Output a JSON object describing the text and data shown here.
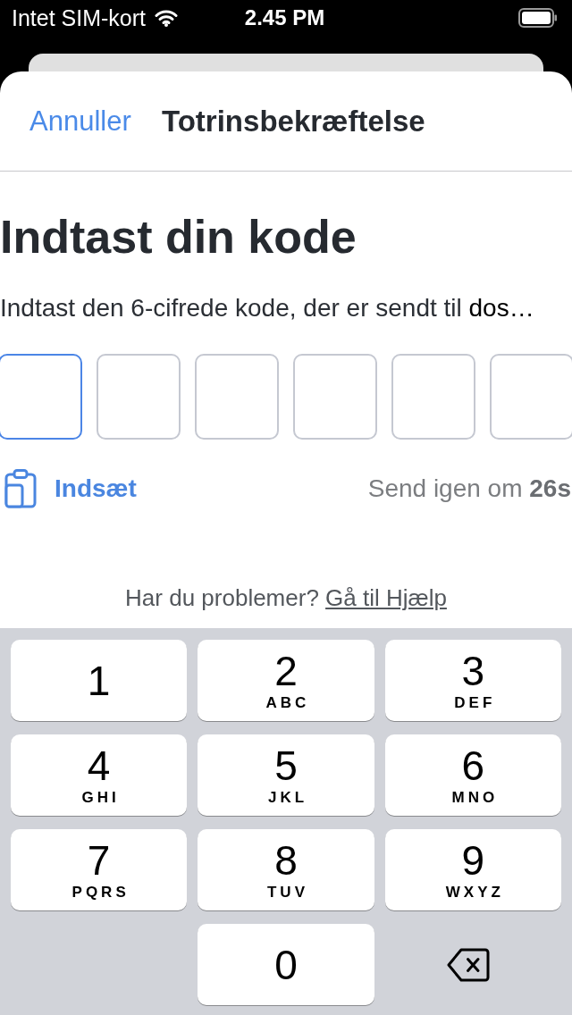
{
  "status_bar": {
    "carrier": "Intet SIM-kort",
    "time": "2.45 PM"
  },
  "header": {
    "cancel": "Annuller",
    "title": "Totrinsbekræftelse"
  },
  "heading": "Indtast din kode",
  "instruction": {
    "text": "Indtast den 6-cifrede kode, der er sendt til",
    "recipient": "dos…"
  },
  "code_fields": [
    {
      "selected": true
    },
    {
      "selected": false
    },
    {
      "selected": false
    },
    {
      "selected": false
    },
    {
      "selected": false
    },
    {
      "selected": false
    }
  ],
  "paste_button": "Indsæt",
  "resend": "Send igen om **26s**",
  "help": {
    "text": "Har du problemer?",
    "link": "Gå til Hjælp"
  },
  "keypad": [
    {
      "kind": "digit",
      "digit": "1"
    },
    {
      "kind": "digit",
      "digit": "2",
      "letters": "ABC"
    },
    {
      "kind": "digit",
      "digit": "3",
      "letters": "DEF"
    },
    {
      "kind": "digit",
      "digit": "4",
      "letters": "GHI"
    },
    {
      "kind": "digit",
      "digit": "5",
      "letters": "JKL"
    },
    {
      "kind": "digit",
      "digit": "6",
      "letters": "MNO"
    },
    {
      "kind": "digit",
      "digit": "7",
      "letters": "PQRS"
    },
    {
      "kind": "digit",
      "digit": "8",
      "letters": "TUV"
    },
    {
      "kind": "digit",
      "digit": "9",
      "letters": "WXYZ"
    },
    {
      "kind": "blank"
    },
    {
      "kind": "digit",
      "digit": "0"
    },
    {
      "kind": "delete"
    }
  ]
}
